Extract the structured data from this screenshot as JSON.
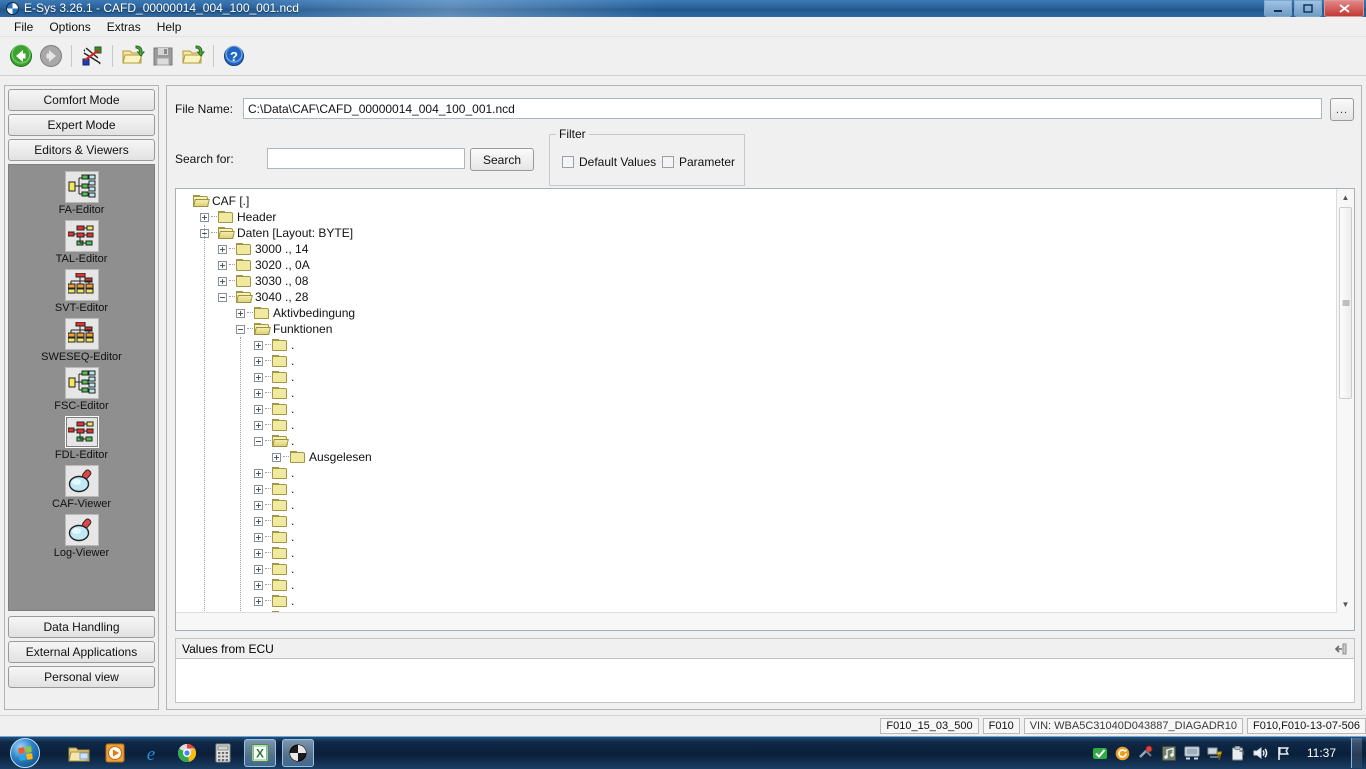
{
  "window": {
    "title": "E-Sys 3.26.1 - CAFD_00000014_004_100_001.ncd",
    "app_icon": "bmw-logo-icon",
    "minimize_label": "—",
    "maximize_label": "❐",
    "close_label": "✕"
  },
  "menu": {
    "items": [
      {
        "label": "File"
      },
      {
        "label": "Options"
      },
      {
        "label": "Extras"
      },
      {
        "label": "Help"
      }
    ]
  },
  "toolbar": {
    "items": [
      {
        "name": "back-button",
        "icon": "back-arrow-icon",
        "enabled": true
      },
      {
        "name": "forward-button",
        "icon": "forward-arrow-icon",
        "enabled": false
      },
      {
        "name": "connection-button",
        "icon": "connect-vehicle-icon",
        "enabled": true
      },
      {
        "name": "open-button",
        "icon": "open-folder-icon",
        "enabled": true
      },
      {
        "name": "save-button",
        "icon": "floppy-save-icon",
        "enabled": false
      },
      {
        "name": "open-recent-button",
        "icon": "open-folder-icon",
        "enabled": true
      },
      {
        "name": "help-button",
        "icon": "question-help-icon",
        "enabled": true
      }
    ]
  },
  "sidebar": {
    "top_buttons": [
      {
        "label": "Comfort Mode",
        "name": "comfort-mode-button"
      },
      {
        "label": "Expert Mode",
        "name": "expert-mode-button"
      },
      {
        "label": "Editors & Viewers",
        "name": "editors-viewers-button"
      }
    ],
    "items": [
      {
        "label": "FA-Editor",
        "icon": "fa-editor-icon",
        "selected": false
      },
      {
        "label": "TAL-Editor",
        "icon": "tal-editor-icon",
        "selected": false
      },
      {
        "label": "SVT-Editor",
        "icon": "svt-editor-icon",
        "selected": false
      },
      {
        "label": "SWESEQ-Editor",
        "icon": "sweseq-editor-icon",
        "selected": false
      },
      {
        "label": "FSC-Editor",
        "icon": "fsc-editor-icon",
        "selected": false
      },
      {
        "label": "FDL-Editor",
        "icon": "fdl-editor-icon",
        "selected": true
      },
      {
        "label": "CAF-Viewer",
        "icon": "magnifier-icon",
        "selected": false
      },
      {
        "label": "Log-Viewer",
        "icon": "magnifier-icon",
        "selected": false
      }
    ],
    "bottom_buttons": [
      {
        "label": "Data Handling",
        "name": "data-handling-button"
      },
      {
        "label": "External Applications",
        "name": "external-applications-button"
      },
      {
        "label": "Personal view",
        "name": "personal-view-button"
      }
    ]
  },
  "main": {
    "file_name_label": "File Name:",
    "file_name_value": "C:\\Data\\CAF\\CAFD_00000014_004_100_001.ncd",
    "browse_label": "...",
    "search_for_label": "Search for:",
    "search_value": "",
    "search_placeholder": "",
    "search_button_label": "Search",
    "filter": {
      "legend": "Filter",
      "default_values_label": "Default Values",
      "default_values_checked": false,
      "parameter_label": "Parameter",
      "parameter_checked": false
    },
    "ecu_panel_title": "Values from ECU",
    "ecu_panel_body": ""
  },
  "tree": {
    "nodes": [
      {
        "depth": 0,
        "label": "CAF [.]",
        "state": "open-root",
        "folder": "open"
      },
      {
        "depth": 1,
        "label": "Header",
        "state": "plus",
        "folder": "closed"
      },
      {
        "depth": 1,
        "label": "Daten [Layout: BYTE]",
        "state": "minus",
        "folder": "open"
      },
      {
        "depth": 2,
        "label": "3000 ., 14",
        "state": "plus",
        "folder": "closed"
      },
      {
        "depth": 2,
        "label": "3020 ., 0A",
        "state": "plus",
        "folder": "closed"
      },
      {
        "depth": 2,
        "label": "3030 ., 08",
        "state": "plus",
        "folder": "closed"
      },
      {
        "depth": 2,
        "label": "3040 ., 28",
        "state": "minus",
        "folder": "open"
      },
      {
        "depth": 3,
        "label": "Aktivbedingung",
        "state": "plus",
        "folder": "closed"
      },
      {
        "depth": 3,
        "label": "Funktionen",
        "state": "minus",
        "folder": "open"
      },
      {
        "depth": 4,
        "label": ".",
        "state": "plus",
        "folder": "closed"
      },
      {
        "depth": 4,
        "label": ".",
        "state": "plus",
        "folder": "closed"
      },
      {
        "depth": 4,
        "label": ".",
        "state": "plus",
        "folder": "closed"
      },
      {
        "depth": 4,
        "label": ".",
        "state": "plus",
        "folder": "closed"
      },
      {
        "depth": 4,
        "label": ".",
        "state": "plus",
        "folder": "closed"
      },
      {
        "depth": 4,
        "label": ".",
        "state": "plus",
        "folder": "closed"
      },
      {
        "depth": 4,
        "label": ".",
        "state": "minus",
        "folder": "open"
      },
      {
        "depth": 5,
        "label": "Ausgelesen",
        "state": "plus",
        "folder": "closed"
      },
      {
        "depth": 4,
        "label": ".",
        "state": "plus",
        "folder": "closed"
      },
      {
        "depth": 4,
        "label": ".",
        "state": "plus",
        "folder": "closed"
      },
      {
        "depth": 4,
        "label": ".",
        "state": "plus",
        "folder": "closed"
      },
      {
        "depth": 4,
        "label": ".",
        "state": "plus",
        "folder": "closed"
      },
      {
        "depth": 4,
        "label": ".",
        "state": "plus",
        "folder": "closed"
      },
      {
        "depth": 4,
        "label": ".",
        "state": "plus",
        "folder": "closed"
      },
      {
        "depth": 4,
        "label": ".",
        "state": "plus",
        "folder": "closed"
      },
      {
        "depth": 4,
        "label": ".",
        "state": "plus",
        "folder": "closed"
      },
      {
        "depth": 4,
        "label": ".",
        "state": "plus",
        "folder": "closed"
      },
      {
        "depth": 4,
        "label": ".",
        "state": "plus",
        "folder": "closed"
      },
      {
        "depth": 4,
        "label": ".",
        "state": "plus",
        "folder": "closed"
      }
    ]
  },
  "statusbar": {
    "cells": [
      {
        "text": "F010_15_03_500",
        "name": "status-cell-ivariant"
      },
      {
        "text": "F010",
        "name": "status-cell-series"
      },
      {
        "text": "VIN: WBA5C31040D043887_DIAGADR10",
        "name": "status-cell-vin"
      },
      {
        "text": "F010,F010-13-07-506",
        "name": "status-cell-target"
      }
    ]
  },
  "taskbar": {
    "start_label": "Start",
    "items": [
      {
        "name": "taskbar-explorer",
        "icon": "folder-icon",
        "active": false
      },
      {
        "name": "taskbar-media-player",
        "icon": "media-player-icon",
        "active": false
      },
      {
        "name": "taskbar-internet-explorer",
        "icon": "internet-explorer-icon",
        "active": false
      },
      {
        "name": "taskbar-chrome",
        "icon": "chrome-icon",
        "active": false
      },
      {
        "name": "taskbar-calculator",
        "icon": "calculator-icon",
        "active": false
      },
      {
        "name": "taskbar-excel",
        "icon": "excel-icon",
        "active": true
      },
      {
        "name": "taskbar-esys",
        "icon": "esys-icon",
        "active": true
      }
    ],
    "tray": [
      {
        "name": "tray-checkmark-icon",
        "icon": "green-check-icon"
      },
      {
        "name": "tray-update-icon",
        "icon": "orange-circle-icon"
      },
      {
        "name": "tray-tools-icon",
        "icon": "tools-icon"
      },
      {
        "name": "tray-music-icon",
        "icon": "music-note-icon"
      },
      {
        "name": "tray-display-icon",
        "icon": "monitor-icon"
      },
      {
        "name": "tray-network-icon",
        "icon": "network-warning-icon"
      },
      {
        "name": "tray-clipboard-icon",
        "icon": "clipboard-icon"
      },
      {
        "name": "tray-volume-icon",
        "icon": "speaker-icon"
      },
      {
        "name": "tray-action-center-icon",
        "icon": "flag-icon"
      }
    ],
    "clock": "11:37"
  },
  "colors": {
    "title_blue": "#2a629c",
    "window_gray": "#f0f0f0",
    "sidebar_panel": "#8f8f8f",
    "folder_yellow": "#f2e9a0",
    "accent_green": "#3aa832"
  }
}
